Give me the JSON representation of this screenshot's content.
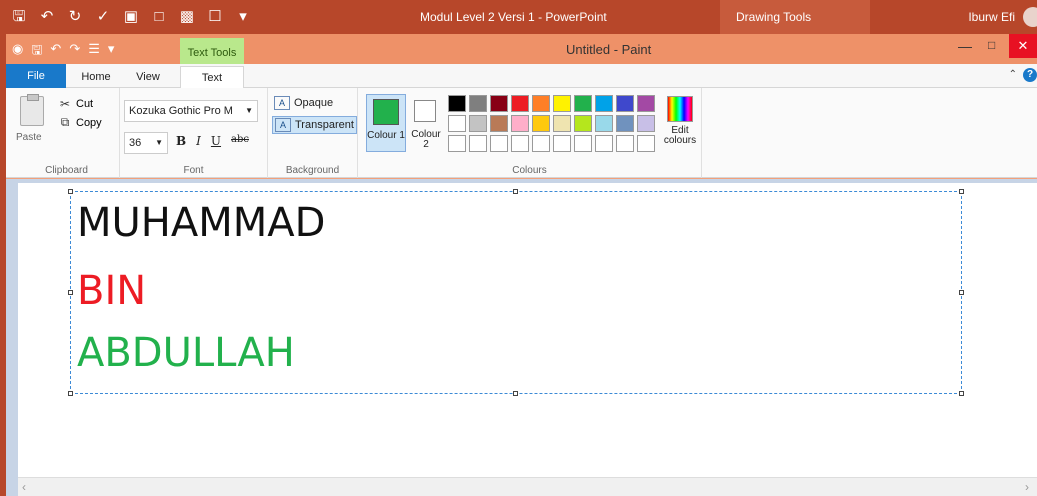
{
  "powerpoint": {
    "title": "Modul Level 2 Versi 1  -  PowerPoint",
    "contextual_tab": "Drawing Tools",
    "user": "Iburw Efi",
    "qat_icons": [
      "save-icon",
      "undo-icon",
      "redo-icon",
      "spelling-icon",
      "slideshow-icon",
      "picture-icon",
      "placeholder-icon",
      "preview-icon",
      "customize-icon"
    ]
  },
  "paint": {
    "title": "Untitled - Paint",
    "contextual_tab": "Text Tools",
    "tabs": {
      "file": "File",
      "home": "Home",
      "view": "View",
      "text": "Text"
    },
    "clipboard": {
      "paste": "Paste",
      "cut": "Cut",
      "copy": "Copy",
      "label": "Clipboard"
    },
    "font": {
      "family": "Kozuka Gothic Pro M",
      "size": "36",
      "bold": "B",
      "italic": "I",
      "underline": "U",
      "strike": "abc",
      "label": "Font"
    },
    "background": {
      "opaque": "Opaque",
      "transparent": "Transparent",
      "label": "Background"
    },
    "colours": {
      "colour1": "Colour 1",
      "colour2": "Colour 2",
      "edit": "Edit colours",
      "label": "Colours",
      "colour1_value": "#22b14c",
      "colour2_value": "#ffffff",
      "palette": [
        "#000000",
        "#7f7f7f",
        "#880015",
        "#ed1c24",
        "#ff7f27",
        "#fff200",
        "#22b14c",
        "#00a2e8",
        "#3f48cc",
        "#a349a4",
        "#ffffff",
        "#c3c3c3",
        "#b97a57",
        "#ffaec9",
        "#ffc90e",
        "#efe4b0",
        "#b5e61d",
        "#99d9ea",
        "#7092be",
        "#c8bfe7",
        "#ffffff",
        "#ffffff",
        "#ffffff",
        "#ffffff",
        "#ffffff",
        "#ffffff",
        "#ffffff",
        "#ffffff",
        "#ffffff",
        "#ffffff"
      ]
    },
    "canvas_text": [
      "MUHAMMAD",
      "BIN",
      "ABDULLAH"
    ]
  }
}
